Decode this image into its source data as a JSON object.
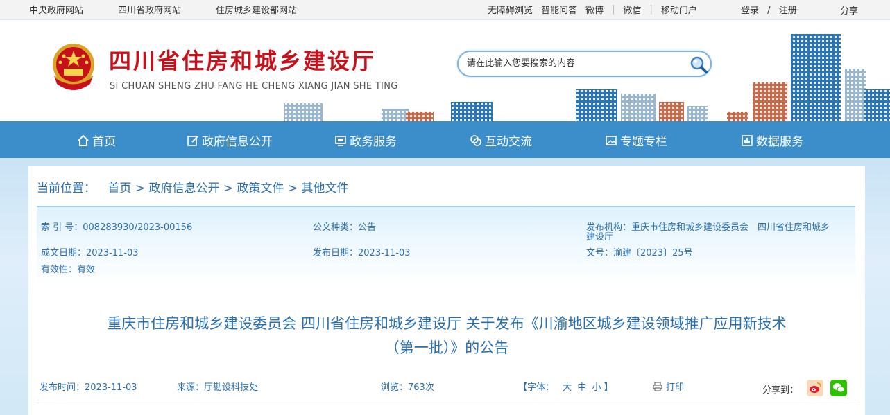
{
  "topbar": {
    "links": [
      "中央政府网站",
      "四川省政府网站",
      "住房城乡建设部网站"
    ],
    "right": [
      "无障碍浏览",
      "智能问答",
      "微博"
    ],
    "right2": [
      "微信"
    ],
    "right3": [
      "移动门户"
    ],
    "login": "登录",
    "slash": "/",
    "register": "注册",
    "share": "分享"
  },
  "header": {
    "title": "四川省住房和城乡建设厅",
    "subtitle": "SI CHUAN SHENG ZHU FANG HE CHENG XIANG JIAN SHE TING",
    "search_placeholder": "请在此输入您要搜索的内容"
  },
  "nav": {
    "items": [
      {
        "label": "首页",
        "icon": "home-icon"
      },
      {
        "label": "政府信息公开",
        "icon": "edit-icon"
      },
      {
        "label": "政务服务",
        "icon": "monitor-icon"
      },
      {
        "label": "互动交流",
        "icon": "chat-icon"
      },
      {
        "label": "专题专栏",
        "icon": "image-icon"
      },
      {
        "label": "数据服务",
        "icon": "chart-icon"
      }
    ]
  },
  "breadcrumb": {
    "label": "当前位置：",
    "path": "首页 > 政府信息公开 > 政策文件 > 其他文件"
  },
  "meta": {
    "index_no": "索 引 号：008283930/2023-00156",
    "doc_type": "公文种类：公告",
    "publisher_1": "发布机构：重庆市住房和城乡建设委员会　四川省住房和城乡",
    "publisher_2": "建设厅",
    "created": "成文日期：2023-11-03",
    "published": "发布日期：2023-11-03",
    "doc_no": "文号：渝建〔2023〕25号",
    "validity": "有效性：有效"
  },
  "article": {
    "title_line1": "重庆市住房和城乡建设委员会 四川省住房和城乡建设厅 关于发布《川渝地区城乡建设领域推广应用新技术",
    "title_line2": "（第一批）》的公告",
    "publish_time": "发布时间：2023-11-03",
    "source": "来源：厅勘设科技处",
    "views": "浏览：763次",
    "font_label": "【字体：",
    "font_large": "大",
    "font_medium": "中",
    "font_small": "小",
    "font_close": "】",
    "print": "打印",
    "share_to": "分享到："
  }
}
